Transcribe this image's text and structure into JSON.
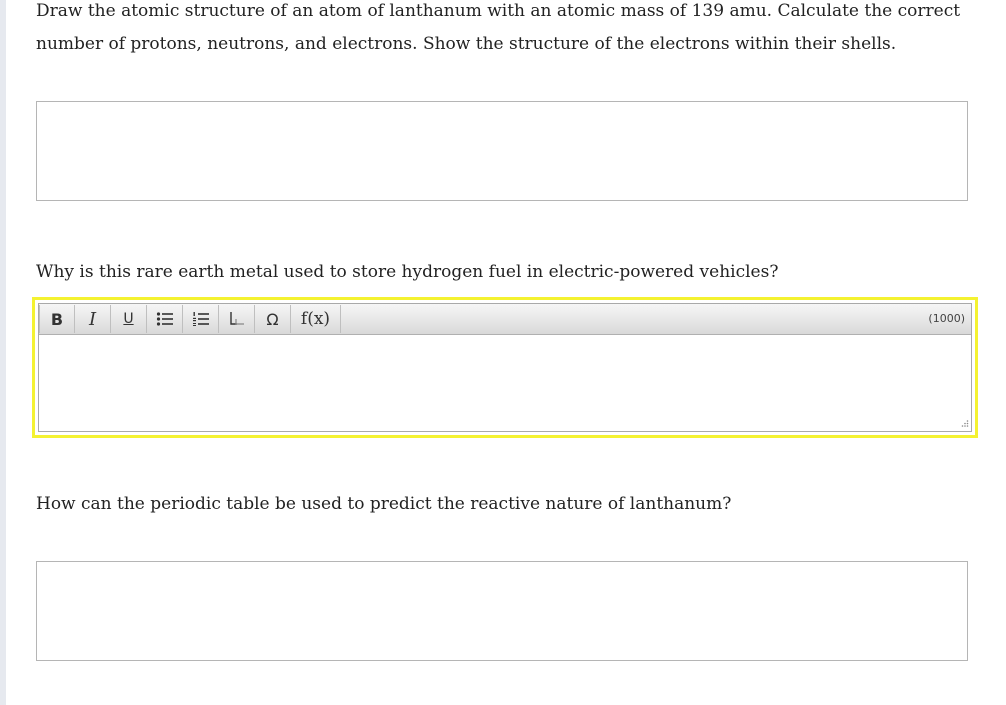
{
  "questions": [
    {
      "text": "Draw the atomic structure of an atom of lanthanum with an atomic mass of 139 amu. Calculate the correct number of protons, neutrons, and electrons. Show the structure of the electrons within their shells."
    },
    {
      "text": "Why is this rare earth metal used to store hydrogen fuel in electric-powered vehicles?"
    },
    {
      "text": "How can the periodic table be used to predict the reactive nature of lanthanum?"
    }
  ],
  "editor": {
    "toolbar": {
      "bold_label": "B",
      "italic_label": "I",
      "underline_label": "U",
      "bullet_list_icon": "bulleted-list-icon",
      "numbered_list_icon": "numbered-list-icon",
      "subscript_icon": "subscript-icon",
      "special_char_label": "Ω",
      "formula_label": "f(x)"
    },
    "char_limit_label": "(1000)",
    "highlight_color": "#f4f231"
  }
}
